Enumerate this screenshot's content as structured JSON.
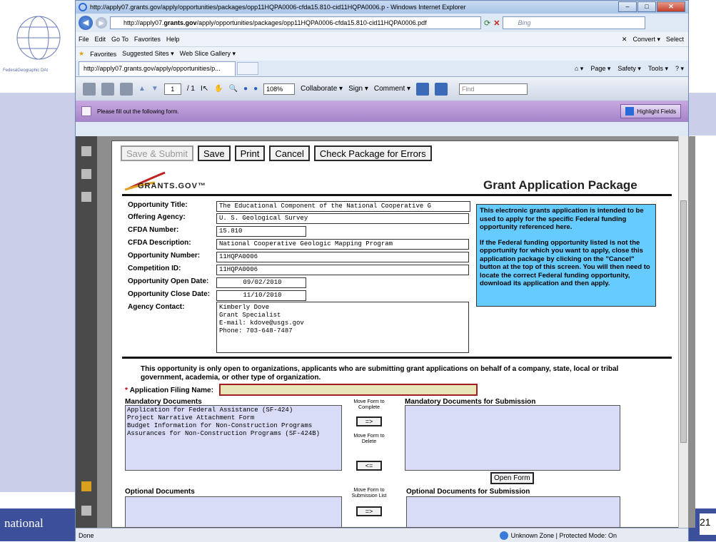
{
  "slide": {
    "footer_text": "national",
    "page_number": "21",
    "logo_text": "FederalGeographic DAt"
  },
  "browser": {
    "title": "http://apply07.grants.gov/apply/opportunities/packages/opp11HQPA0006-cfda15.810-cid11HQPA0006.p - Windows Internet Explorer",
    "address_prefix": "http://apply07.",
    "address_domain": "grants.gov",
    "address_rest": "/apply/opportunities/packages/opp11HQPA0006-cfda15.810-cid11HQPA0006.pdf",
    "search_placeholder": "Bing",
    "menu": [
      "File",
      "Edit",
      "Go To",
      "Favorites",
      "Help"
    ],
    "menu_right": [
      "Convert ▾",
      "Select"
    ],
    "favorites": [
      "Favorites",
      "Suggested Sites ▾",
      "Web Slice Gallery ▾"
    ],
    "tab_title": "http://apply07.grants.gov/apply/opportunities/p...",
    "tab_tools": [
      "Page ▾",
      "Safety ▾",
      "Tools ▾"
    ],
    "status_left": "Done",
    "status_zone": "Unknown Zone | Protected Mode: On"
  },
  "pdf_toolbar": {
    "page_current": "1",
    "page_total": "/ 1",
    "zoom": "108%",
    "collaborate": "Collaborate ▾",
    "sign": "Sign ▾",
    "comment": "Comment ▾",
    "find_placeholder": "Find"
  },
  "formbar": {
    "message": "Please fill out the following form.",
    "highlight_label": "Highlight Fields"
  },
  "form": {
    "buttons": {
      "save_submit": "Save & Submit",
      "save": "Save",
      "print": "Print",
      "cancel": "Cancel",
      "check": "Check Package for Errors"
    },
    "logo_text": "GRANTS.GOV™",
    "package_title": "Grant Application Package",
    "fields": {
      "opportunity_title_label": "Opportunity Title:",
      "opportunity_title": "The Educational Component of the National Cooperative G",
      "offering_agency_label": "Offering Agency:",
      "offering_agency": "U. S. Geological Survey",
      "cfda_number_label": "CFDA Number:",
      "cfda_number": "15.810",
      "cfda_description_label": "CFDA Description:",
      "cfda_description": "National Cooperative Geologic Mapping Program",
      "opportunity_number_label": "Opportunity Number:",
      "opportunity_number": "11HQPA0006",
      "competition_id_label": "Competition ID:",
      "competition_id": "11HQPA0006",
      "open_date_label": "Opportunity Open Date:",
      "open_date": "09/02/2010",
      "close_date_label": "Opportunity Close Date:",
      "close_date": "11/10/2010",
      "agency_contact_label": "Agency Contact:",
      "agency_contact": "Kimberly Dove\nGrant Specialist\nE-mail: kdove@usgs.gov\nPhone: 703-648-7487"
    },
    "notice_1": "This electronic grants application is intended to be used to apply for the specific Federal funding opportunity referenced here.",
    "notice_2": "If the Federal funding opportunity listed is not the opportunity for which you want to apply, close this application package by clicking on the \"Cancel\" button at the top of this screen. You will then need to locate the correct Federal funding opportunity, download its application and then apply.",
    "eligibility": "This opportunity is only open to organizations, applicants who are submitting grant applications on behalf of a company, state, local or tribal government, academia, or other type of organization.",
    "filing_name_label": "Application Filing Name:",
    "filing_name_required": "*",
    "mandatory_docs_label": "Mandatory Documents",
    "mandatory_docs": [
      "Application for Federal Assistance (SF-424)",
      "Project Narrative Attachment Form",
      "Budget Information for Non-Construction Programs",
      "Assurances for Non-Construction Programs (SF-424B)"
    ],
    "move_complete_label": "Move Form to Complete",
    "move_delete_label": "Move Form to Delete",
    "move_right": "=>",
    "move_left": "<=",
    "mandatory_submit_label": "Mandatory Documents for Submission",
    "open_form": "Open Form",
    "optional_docs_label": "Optional Documents",
    "move_submission_label": "Move Form to Submission List",
    "optional_submit_label": "Optional Documents for Submission"
  }
}
